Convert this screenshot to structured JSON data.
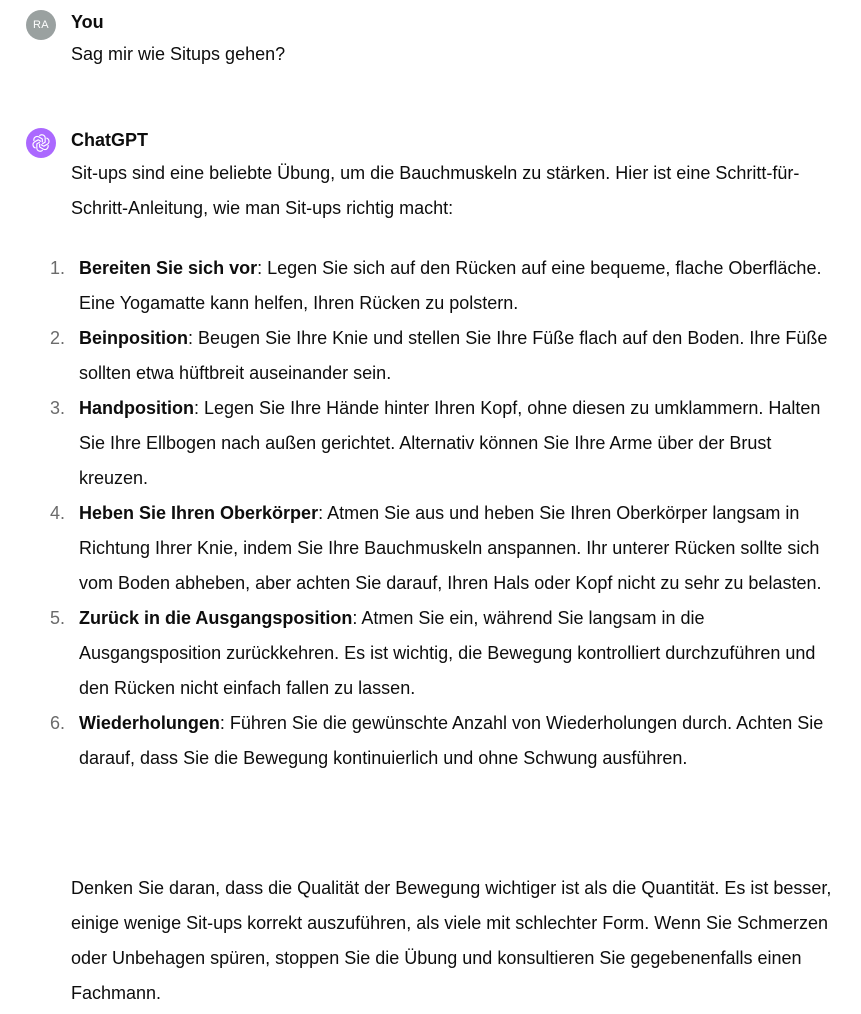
{
  "user_message": {
    "avatar_initials": "RA",
    "author": "You",
    "text": "Sag mir wie Situps gehen?"
  },
  "assistant_message": {
    "author": "ChatGPT",
    "avatar_icon": "openai-logo-icon",
    "avatar_color": "#ab68ff",
    "intro": "Sit-ups sind eine beliebte Übung, um die Bauchmuskeln zu stärken. Hier ist eine Schritt-für-Schritt-Anleitung, wie man Sit-ups richtig macht:",
    "steps": [
      {
        "num": "1.",
        "title": "Bereiten Sie sich vor",
        "text": ": Legen Sie sich auf den Rücken auf eine bequeme, flache Oberfläche. Eine Yogamatte kann helfen, Ihren Rücken zu polstern."
      },
      {
        "num": "2.",
        "title": "Beinposition",
        "text": ": Beugen Sie Ihre Knie und stellen Sie Ihre Füße flach auf den Boden. Ihre Füße sollten etwa hüftbreit auseinander sein."
      },
      {
        "num": "3.",
        "title": "Handposition",
        "text": ": Legen Sie Ihre Hände hinter Ihren Kopf, ohne diesen zu umklammern. Halten Sie Ihre Ellbogen nach außen gerichtet. Alternativ können Sie Ihre Arme über der Brust kreuzen."
      },
      {
        "num": "4.",
        "title": "Heben Sie Ihren Oberkörper",
        "text": ": Atmen Sie aus und heben Sie Ihren Oberkörper langsam in Richtung Ihrer Knie, indem Sie Ihre Bauchmuskeln anspannen. Ihr unterer Rücken sollte sich vom Boden abheben, aber achten Sie darauf, Ihren Hals oder Kopf nicht zu sehr zu belasten."
      },
      {
        "num": "5.",
        "title": "Zurück in die Ausgangsposition",
        "text": ": Atmen Sie ein, während Sie langsam in die Ausgangsposition zurückkehren. Es ist wichtig, die Bewegung kontrolliert durchzuführen und den Rücken nicht einfach fallen zu lassen."
      },
      {
        "num": "6.",
        "title": "Wiederholungen",
        "text": ": Führen Sie die gewünschte Anzahl von Wiederholungen durch. Achten Sie darauf, dass Sie die Bewegung kontinuierlich und ohne Schwung ausführen."
      }
    ],
    "outro": "Denken Sie daran, dass die Qualität der Bewegung wichtiger ist als die Quantität. Es ist besser, einige wenige Sit-ups korrekt auszuführen, als viele mit schlechter Form. Wenn Sie Schmerzen oder Unbehagen spüren, stoppen Sie die Übung und konsultieren Sie gegebenenfalls einen Fachmann."
  }
}
